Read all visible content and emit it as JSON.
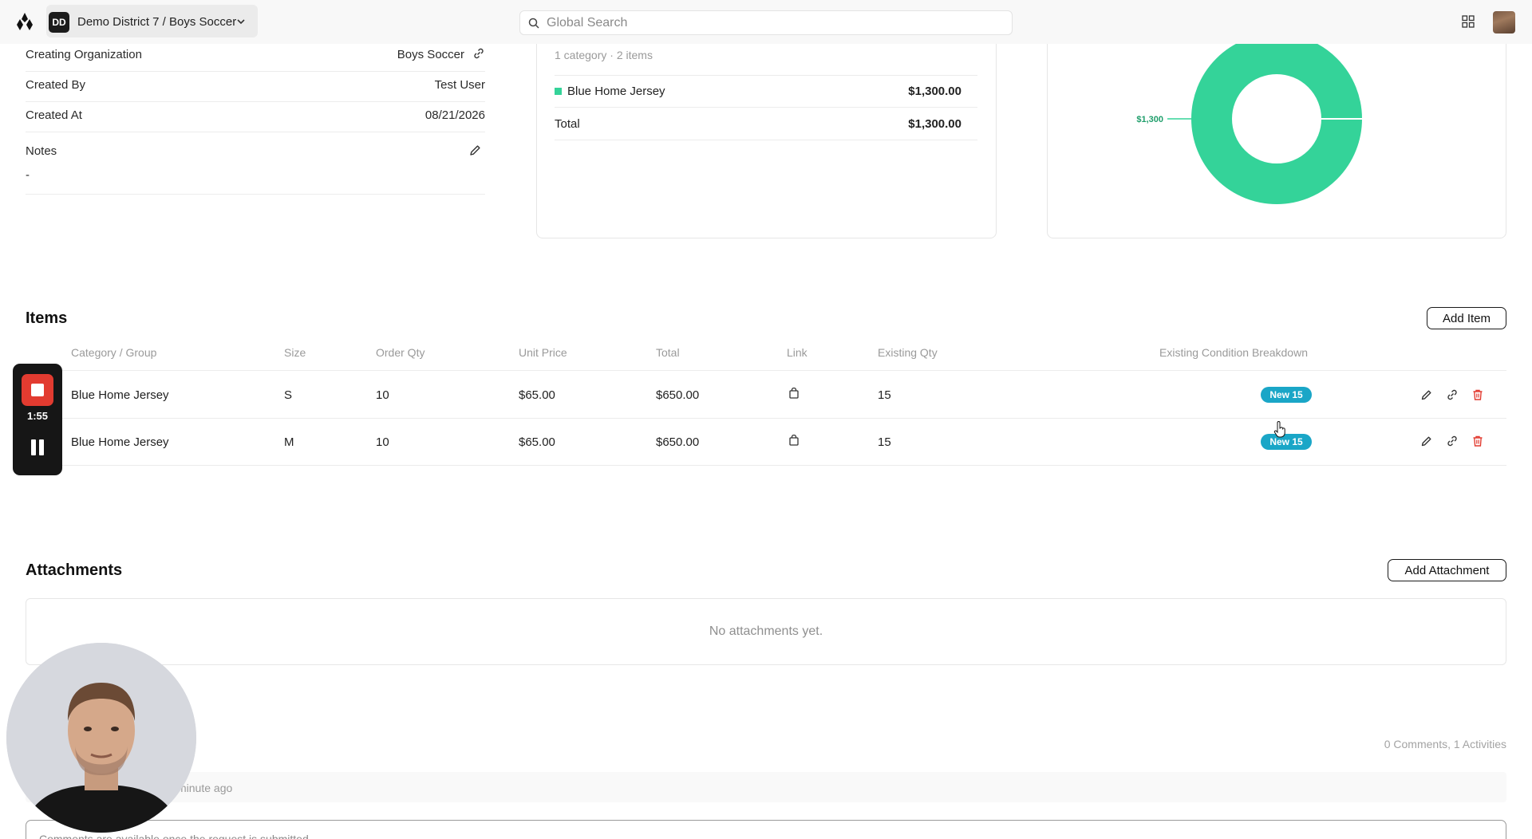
{
  "header": {
    "org_initials": "DD",
    "org_name": "Demo District 7 / Boys Soccer",
    "search_placeholder": "Global Search"
  },
  "details": {
    "creating_org_label": "Creating Organization",
    "creating_org_value": "Boys Soccer",
    "created_by_label": "Created By",
    "created_by_value": "Test User",
    "created_at_label": "Created At",
    "created_at_value": "08/21/2026",
    "notes_label": "Notes",
    "notes_value": "-"
  },
  "budget": {
    "subtitle": "1 category · 2 items",
    "category_name": "Blue Home Jersey",
    "category_amount": "$1,300.00",
    "total_label": "Total",
    "total_amount": "$1,300.00"
  },
  "chart_data": {
    "type": "pie",
    "categories": [
      "Blue Home Jersey"
    ],
    "values": [
      1300
    ],
    "slice_labels": [
      "$1,300"
    ],
    "colors": [
      "#34d399"
    ],
    "donut": true
  },
  "items": {
    "title": "Items",
    "add_label": "Add Item",
    "columns": [
      "Category / Group",
      "Size",
      "Order Qty",
      "Unit Price",
      "Total",
      "Link",
      "Existing Qty",
      "Existing Condition Breakdown"
    ],
    "rows": [
      {
        "name": "Blue Home Jersey",
        "size": "S",
        "qty": "10",
        "unit_price": "$65.00",
        "total": "$650.00",
        "existing": "15",
        "condition": "New 15"
      },
      {
        "name": "Blue Home Jersey",
        "size": "M",
        "qty": "10",
        "unit_price": "$65.00",
        "total": "$650.00",
        "existing": "15",
        "condition": "New 15"
      }
    ]
  },
  "attachments": {
    "title": "Attachments",
    "add_label": "Add Attachment",
    "empty_text": "No attachments yet."
  },
  "activity": {
    "counts": "0 Comments, 1 Activities",
    "time_fragment": "minute ago",
    "comment_placeholder": "Comments are available once the request is submitted"
  },
  "recorder": {
    "time": "1:55"
  },
  "colors": {
    "accent_green": "#34d399",
    "badge_teal": "#1aa6c7",
    "delete_red": "#e23b30"
  }
}
